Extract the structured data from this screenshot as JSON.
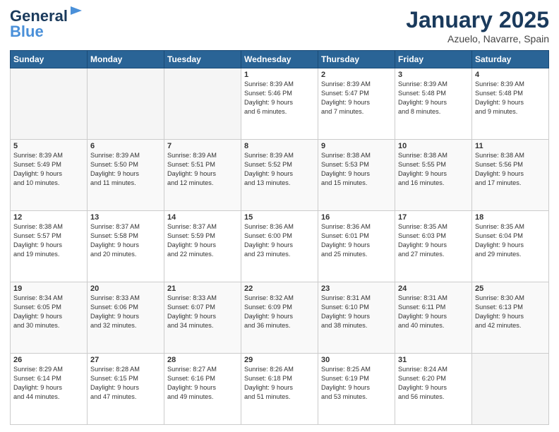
{
  "header": {
    "logo_line1": "General",
    "logo_line2": "Blue",
    "month_year": "January 2025",
    "location": "Azuelo, Navarre, Spain"
  },
  "weekdays": [
    "Sunday",
    "Monday",
    "Tuesday",
    "Wednesday",
    "Thursday",
    "Friday",
    "Saturday"
  ],
  "weeks": [
    [
      {
        "day": "",
        "content": ""
      },
      {
        "day": "",
        "content": ""
      },
      {
        "day": "",
        "content": ""
      },
      {
        "day": "1",
        "content": "Sunrise: 8:39 AM\nSunset: 5:46 PM\nDaylight: 9 hours\nand 6 minutes."
      },
      {
        "day": "2",
        "content": "Sunrise: 8:39 AM\nSunset: 5:47 PM\nDaylight: 9 hours\nand 7 minutes."
      },
      {
        "day": "3",
        "content": "Sunrise: 8:39 AM\nSunset: 5:48 PM\nDaylight: 9 hours\nand 8 minutes."
      },
      {
        "day": "4",
        "content": "Sunrise: 8:39 AM\nSunset: 5:48 PM\nDaylight: 9 hours\nand 9 minutes."
      }
    ],
    [
      {
        "day": "5",
        "content": "Sunrise: 8:39 AM\nSunset: 5:49 PM\nDaylight: 9 hours\nand 10 minutes."
      },
      {
        "day": "6",
        "content": "Sunrise: 8:39 AM\nSunset: 5:50 PM\nDaylight: 9 hours\nand 11 minutes."
      },
      {
        "day": "7",
        "content": "Sunrise: 8:39 AM\nSunset: 5:51 PM\nDaylight: 9 hours\nand 12 minutes."
      },
      {
        "day": "8",
        "content": "Sunrise: 8:39 AM\nSunset: 5:52 PM\nDaylight: 9 hours\nand 13 minutes."
      },
      {
        "day": "9",
        "content": "Sunrise: 8:38 AM\nSunset: 5:53 PM\nDaylight: 9 hours\nand 15 minutes."
      },
      {
        "day": "10",
        "content": "Sunrise: 8:38 AM\nSunset: 5:55 PM\nDaylight: 9 hours\nand 16 minutes."
      },
      {
        "day": "11",
        "content": "Sunrise: 8:38 AM\nSunset: 5:56 PM\nDaylight: 9 hours\nand 17 minutes."
      }
    ],
    [
      {
        "day": "12",
        "content": "Sunrise: 8:38 AM\nSunset: 5:57 PM\nDaylight: 9 hours\nand 19 minutes."
      },
      {
        "day": "13",
        "content": "Sunrise: 8:37 AM\nSunset: 5:58 PM\nDaylight: 9 hours\nand 20 minutes."
      },
      {
        "day": "14",
        "content": "Sunrise: 8:37 AM\nSunset: 5:59 PM\nDaylight: 9 hours\nand 22 minutes."
      },
      {
        "day": "15",
        "content": "Sunrise: 8:36 AM\nSunset: 6:00 PM\nDaylight: 9 hours\nand 23 minutes."
      },
      {
        "day": "16",
        "content": "Sunrise: 8:36 AM\nSunset: 6:01 PM\nDaylight: 9 hours\nand 25 minutes."
      },
      {
        "day": "17",
        "content": "Sunrise: 8:35 AM\nSunset: 6:03 PM\nDaylight: 9 hours\nand 27 minutes."
      },
      {
        "day": "18",
        "content": "Sunrise: 8:35 AM\nSunset: 6:04 PM\nDaylight: 9 hours\nand 29 minutes."
      }
    ],
    [
      {
        "day": "19",
        "content": "Sunrise: 8:34 AM\nSunset: 6:05 PM\nDaylight: 9 hours\nand 30 minutes."
      },
      {
        "day": "20",
        "content": "Sunrise: 8:33 AM\nSunset: 6:06 PM\nDaylight: 9 hours\nand 32 minutes."
      },
      {
        "day": "21",
        "content": "Sunrise: 8:33 AM\nSunset: 6:07 PM\nDaylight: 9 hours\nand 34 minutes."
      },
      {
        "day": "22",
        "content": "Sunrise: 8:32 AM\nSunset: 6:09 PM\nDaylight: 9 hours\nand 36 minutes."
      },
      {
        "day": "23",
        "content": "Sunrise: 8:31 AM\nSunset: 6:10 PM\nDaylight: 9 hours\nand 38 minutes."
      },
      {
        "day": "24",
        "content": "Sunrise: 8:31 AM\nSunset: 6:11 PM\nDaylight: 9 hours\nand 40 minutes."
      },
      {
        "day": "25",
        "content": "Sunrise: 8:30 AM\nSunset: 6:13 PM\nDaylight: 9 hours\nand 42 minutes."
      }
    ],
    [
      {
        "day": "26",
        "content": "Sunrise: 8:29 AM\nSunset: 6:14 PM\nDaylight: 9 hours\nand 44 minutes."
      },
      {
        "day": "27",
        "content": "Sunrise: 8:28 AM\nSunset: 6:15 PM\nDaylight: 9 hours\nand 47 minutes."
      },
      {
        "day": "28",
        "content": "Sunrise: 8:27 AM\nSunset: 6:16 PM\nDaylight: 9 hours\nand 49 minutes."
      },
      {
        "day": "29",
        "content": "Sunrise: 8:26 AM\nSunset: 6:18 PM\nDaylight: 9 hours\nand 51 minutes."
      },
      {
        "day": "30",
        "content": "Sunrise: 8:25 AM\nSunset: 6:19 PM\nDaylight: 9 hours\nand 53 minutes."
      },
      {
        "day": "31",
        "content": "Sunrise: 8:24 AM\nSunset: 6:20 PM\nDaylight: 9 hours\nand 56 minutes."
      },
      {
        "day": "",
        "content": ""
      }
    ]
  ]
}
